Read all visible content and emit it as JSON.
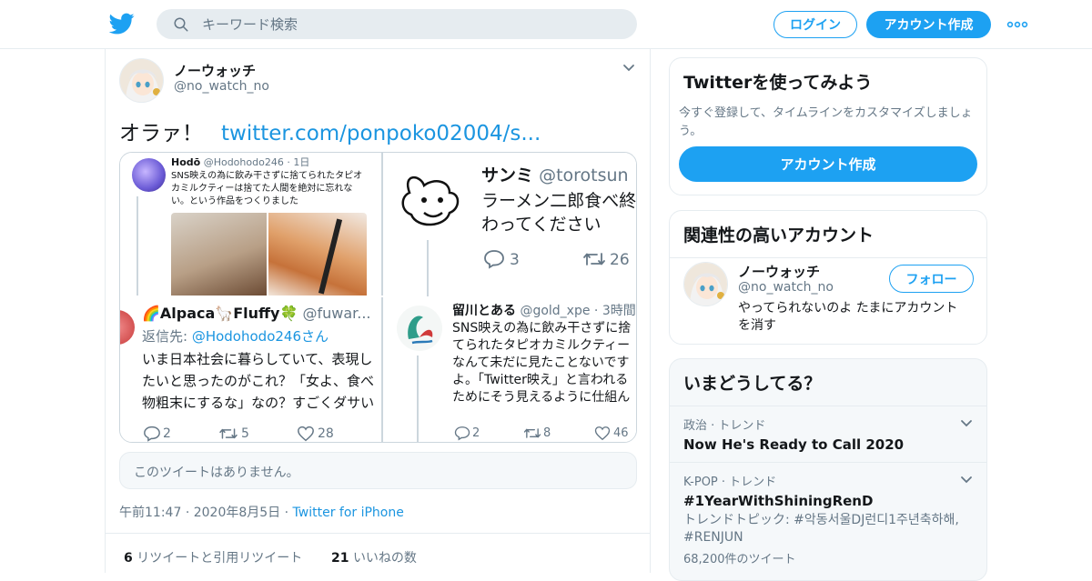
{
  "header": {
    "search_placeholder": "キーワード検索",
    "login_label": "ログイン",
    "signup_label": "アカウント作成"
  },
  "tweet": {
    "author_name": "ノーウォッチ",
    "author_handle": "@no_watch_no",
    "text": "オラァ！",
    "link_text": "twitter.com/ponpoko02004/s...",
    "unavailable_text": "このツイートはありません。",
    "time": "午前11:47",
    "date": "2020年8月5日",
    "via": "Twitter for iPhone",
    "retweet_count": "6",
    "retweet_label": "リツイートと引用リツイート",
    "like_count": "21",
    "like_label": "いいねの数"
  },
  "media": {
    "p1": {
      "name": "Hodō",
      "handle": "@Hodohodo246",
      "time": "· 1日",
      "text": "SNS映えの為に飲み干さずに捨てられたタピオカミルクティーは捨てた人間を絶対に忘れない。という作品をつくりました"
    },
    "p2": {
      "name": "サンミ",
      "handle": "@torotsun",
      "text": "ラーメン二郎食べ終わってください",
      "replies": "3",
      "retweets": "26"
    },
    "p3": {
      "name": "🌈Alpaca🦙Fluffy🍀",
      "handle": "@fuwar...",
      "reply_to_label": "返信先: ",
      "reply_to": "@Hodohodo246さん",
      "text": "いま日本社会に暮らしていて、表現したいと思ったのがこれ？「女よ、食べ物粗末にするな」なの？すごくダサいと思う。",
      "replies": "2",
      "retweets": "5",
      "likes": "28"
    },
    "p4": {
      "name": "留川とある",
      "handle": "@gold_xpe",
      "time": "· 3時間",
      "text": "SNS映えの為に飲み干さずに捨てられたタピオカミルクティーなんて未だに見たことないですよ。「Twitter映え」と言われるためにそう見えるように仕組んだ作品には見えにいましたが。",
      "replies": "2",
      "retweets": "8",
      "likes": "46"
    }
  },
  "sidebar": {
    "signup_card": {
      "title": "Twitterを使ってみよう",
      "description": "今すぐ登録して、タイムラインをカスタマイズしましょう。",
      "button_label": "アカウント作成"
    },
    "related_card": {
      "title": "関連性の高いアカウント",
      "account_name": "ノーウォッチ",
      "account_handle": "@no_watch_no",
      "bio": "やってられないのよ たまにアカウントを消す",
      "follow_label": "フォロー"
    },
    "trends_card": {
      "title": "いまどうしてる？",
      "items": [
        {
          "category": "政治 · トレンド",
          "name": "Now He's Ready to Call 2020"
        },
        {
          "category": "K-POP · トレンド",
          "name": "#1YearWithShiningRenD",
          "description": "トレンドトピック: #악동서울DJ런디1주년축하해, #RENJUN",
          "count": "68,200件のツイート"
        }
      ]
    }
  },
  "colors": {
    "accent": "#1da1f2",
    "link": "#1b95e0",
    "muted": "#657786",
    "border": "#e6ecf0"
  }
}
